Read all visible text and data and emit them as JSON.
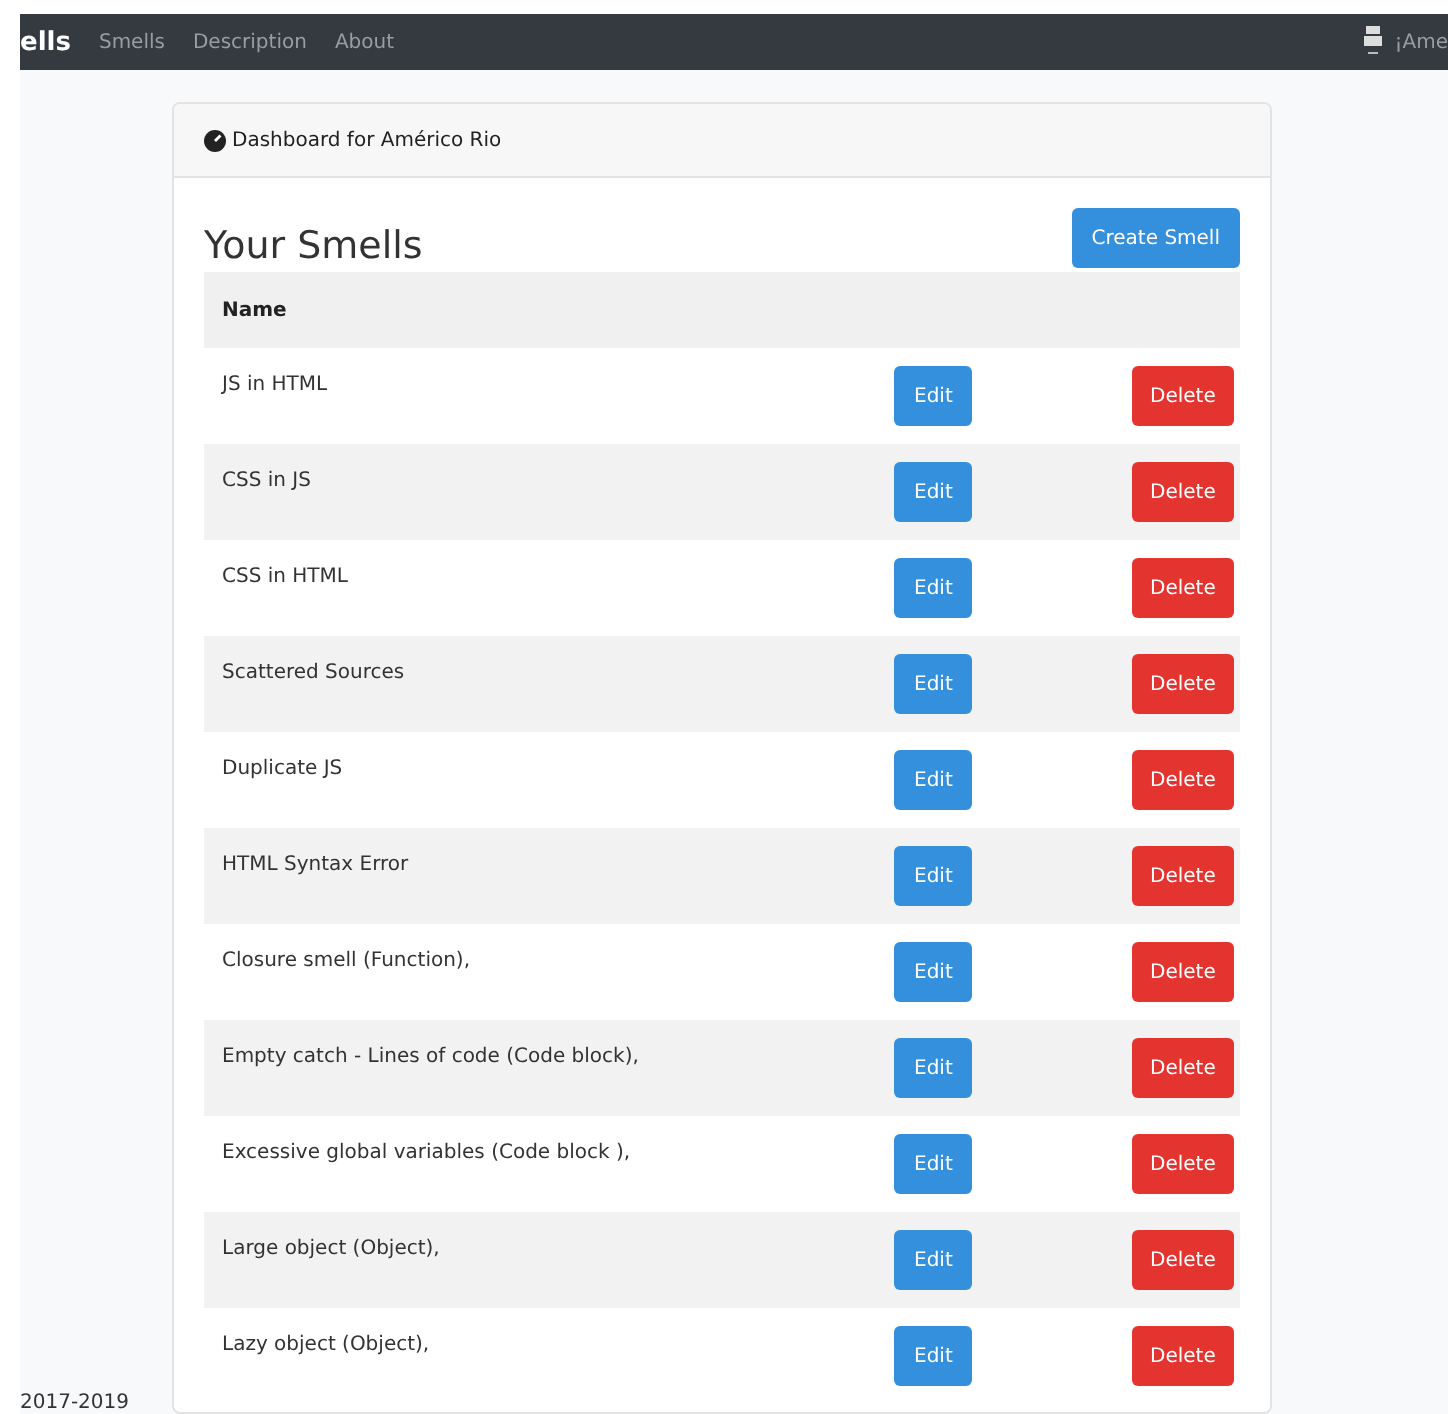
{
  "navbar": {
    "brand": "ells",
    "links": [
      "Smells",
      "Description",
      "About"
    ],
    "user": "¡Ame"
  },
  "card": {
    "header": "Dashboard for Américo Rio",
    "title": "Your Smells",
    "create_button": "Create Smell",
    "table": {
      "columns": [
        "Name"
      ],
      "rows": [
        {
          "name": "JS in HTML",
          "edit": "Edit",
          "delete": "Delete"
        },
        {
          "name": "CSS in JS",
          "edit": "Edit",
          "delete": "Delete"
        },
        {
          "name": "CSS in HTML",
          "edit": "Edit",
          "delete": "Delete"
        },
        {
          "name": "Scattered Sources",
          "edit": "Edit",
          "delete": "Delete"
        },
        {
          "name": "Duplicate JS",
          "edit": "Edit",
          "delete": "Delete"
        },
        {
          "name": "HTML Syntax Error",
          "edit": "Edit",
          "delete": "Delete"
        },
        {
          "name": "Closure smell (Function),",
          "edit": "Edit",
          "delete": "Delete"
        },
        {
          "name": "Empty catch - Lines of code (Code block),",
          "edit": "Edit",
          "delete": "Delete"
        },
        {
          "name": "Excessive global variables (Code block ),",
          "edit": "Edit",
          "delete": "Delete"
        },
        {
          "name": "Large object (Object),",
          "edit": "Edit",
          "delete": "Delete"
        },
        {
          "name": "Lazy object (Object),",
          "edit": "Edit",
          "delete": "Delete"
        }
      ]
    }
  },
  "footer": "2017-2019"
}
